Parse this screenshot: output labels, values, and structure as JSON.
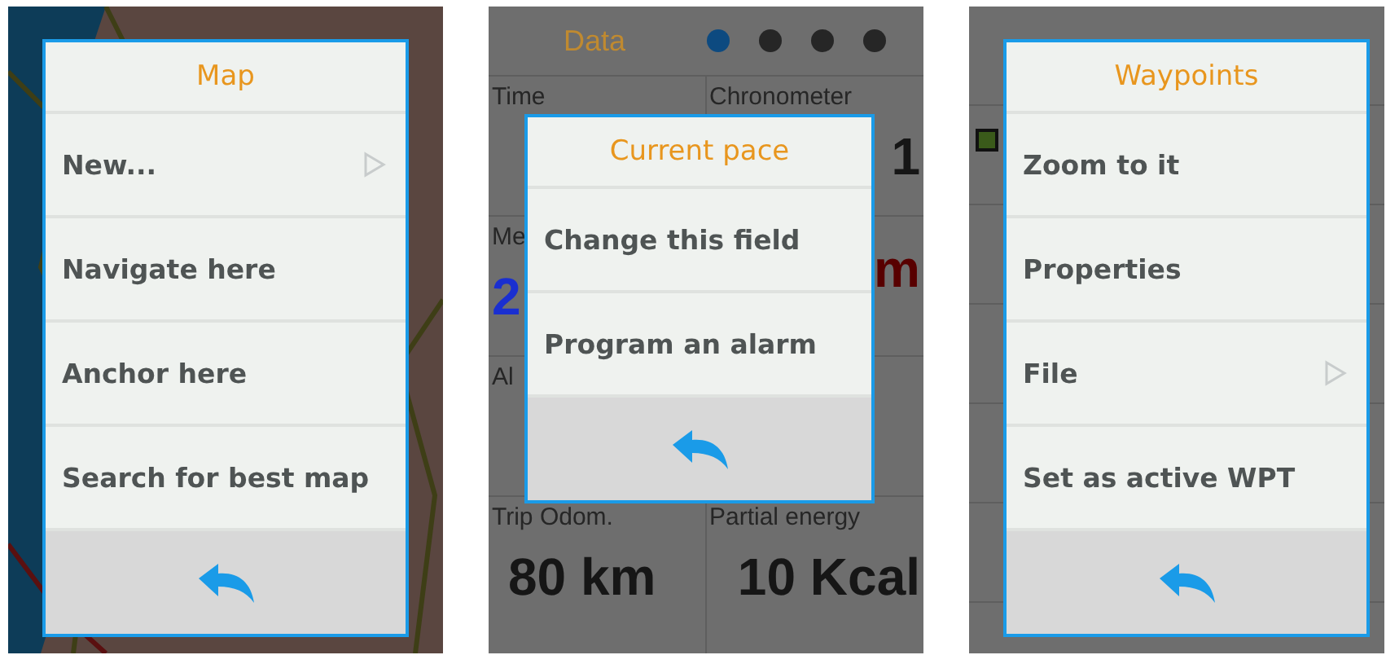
{
  "screens": [
    {
      "kind": "map",
      "popup": {
        "title": "Map",
        "items": [
          {
            "label": "New...",
            "submenu": true
          },
          {
            "label": "Navigate here",
            "submenu": false
          },
          {
            "label": "Anchor here",
            "submenu": false
          },
          {
            "label": "Search for best map",
            "submenu": false
          }
        ]
      }
    },
    {
      "kind": "data",
      "header": {
        "title": "Data",
        "dots": [
          {
            "selected": true
          },
          {
            "selected": false
          },
          {
            "selected": false
          },
          {
            "selected": false
          }
        ]
      },
      "cells": [
        {
          "label": "Time"
        },
        {
          "label": "Chronometer",
          "value": "1"
        },
        {
          "label": "Me",
          "value": "2",
          "color": "#1a2fd0"
        },
        {
          "value": "m",
          "color": "#580000"
        },
        {
          "label": "Al"
        },
        {},
        {
          "label": "Trip Odom.",
          "value": "80 km"
        },
        {
          "label": "Partial energy",
          "value": "10 Kcal"
        }
      ],
      "popup": {
        "title": "Current pace",
        "items": [
          {
            "label": "Change this field",
            "submenu": false
          },
          {
            "label": "Program an alarm",
            "submenu": false
          }
        ]
      }
    },
    {
      "kind": "list",
      "popup": {
        "title": "Waypoints",
        "items": [
          {
            "label": "Zoom to it",
            "submenu": false
          },
          {
            "label": "Properties",
            "submenu": false
          },
          {
            "label": "File",
            "submenu": true
          },
          {
            "label": "Set as active WPT",
            "submenu": false
          }
        ]
      }
    }
  ]
}
